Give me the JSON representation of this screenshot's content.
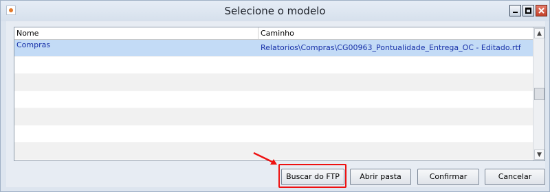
{
  "window": {
    "title": "Selecione o modelo",
    "buttons": {
      "minimize": "minimize-icon",
      "maximize": "maximize-icon",
      "close": "close-icon"
    }
  },
  "grid": {
    "columns": [
      "Nome",
      "Caminho"
    ],
    "rows": [
      {
        "nome": "Compras",
        "caminho": "Relatorios\\Compras\\CG00963_Pontualidade_Entrega_OC - Editado.rtf",
        "selected": true
      }
    ],
    "empty_rows": 7
  },
  "buttons": {
    "buscar_ftp": "Buscar do FTP",
    "abrir_pasta": "Abrir pasta",
    "confirmar": "Confirmar",
    "cancelar": "Cancelar"
  },
  "colors": {
    "selection": "#c3dbf6",
    "highlight": "#ee1111",
    "selected_text": "#1730a8"
  }
}
